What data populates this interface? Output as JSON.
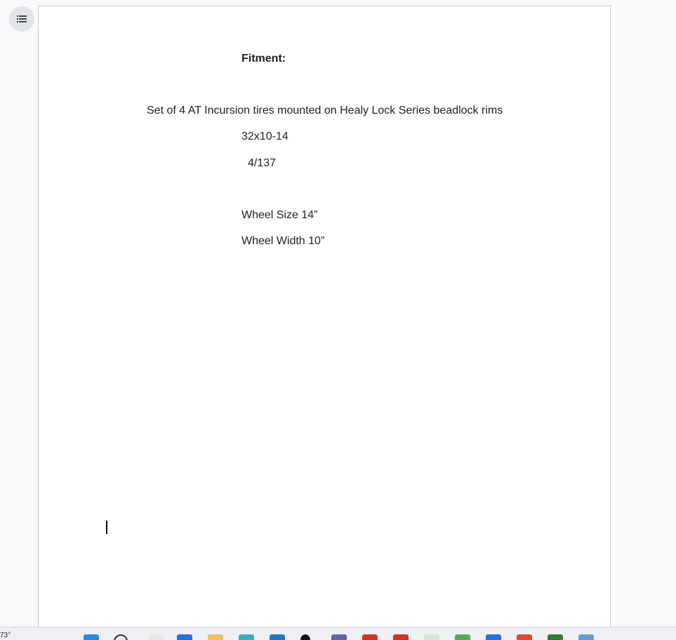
{
  "doc": {
    "heading": "Fitment:",
    "description": "Set of 4 AT Incursion tires mounted on Healy Lock Series beadlock rims",
    "tire_size": "32x10-14",
    "bolt_pattern": "4/137",
    "wheel_size": "Wheel Size 14”",
    "wheel_width": "Wheel Width 10”"
  },
  "taskbar": {
    "weather_temp": "73°",
    "icons": [
      {
        "name": "start-icon",
        "color": "#1e90e8"
      },
      {
        "name": "search-icon",
        "color": "#333333"
      },
      {
        "name": "task-view-icon",
        "color": "#e8e8e8"
      },
      {
        "name": "edge-icon",
        "color": "#1a73e8"
      },
      {
        "name": "file-explorer-icon",
        "color": "#f2c14e"
      },
      {
        "name": "browser-icon",
        "color": "#2bb3c0"
      },
      {
        "name": "store-icon",
        "color": "#1976d2"
      },
      {
        "name": "app-icon",
        "color": "#111111"
      },
      {
        "name": "teams-icon",
        "color": "#6264a7"
      },
      {
        "name": "chrome-profile-icon",
        "color": "#d93025"
      },
      {
        "name": "chrome-profile-k-icon",
        "color": "#d93025"
      },
      {
        "name": "app-green-icon",
        "color": "#cde9cd"
      },
      {
        "name": "photos-icon",
        "color": "#4caf50"
      },
      {
        "name": "calendar-icon",
        "color": "#1a73e8"
      },
      {
        "name": "chrome-icon",
        "color": "#ea4335"
      },
      {
        "name": "edit-icon",
        "color": "#2e7d32"
      },
      {
        "name": "monitor-icon",
        "color": "#5f9fd6"
      }
    ]
  }
}
